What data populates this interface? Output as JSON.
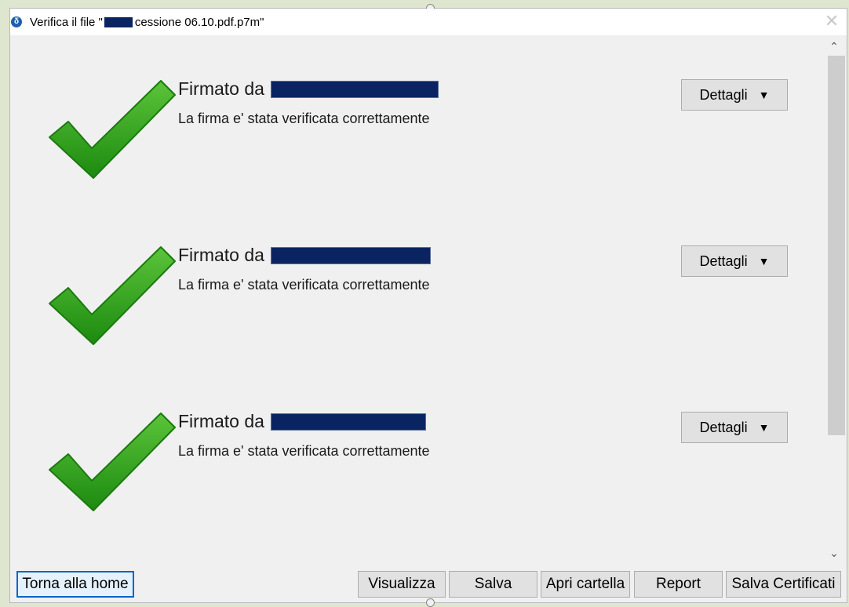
{
  "window": {
    "title_prefix": "Verifica il file \"",
    "title_suffix": "cessione 06.10.pdf.p7m\"",
    "app_icon": "δ",
    "close_symbol": "✕"
  },
  "signatures": [
    {
      "signer_label": "Firmato da",
      "status": "La firma e' stata verificata correttamente",
      "details_label": "Dettagli",
      "caret": "▼"
    },
    {
      "signer_label": "Firmato da",
      "status": "La firma e' stata verificata correttamente",
      "details_label": "Dettagli",
      "caret": "▼"
    },
    {
      "signer_label": "Firmato da",
      "status": "La firma e' stata verificata correttamente",
      "details_label": "Dettagli",
      "caret": "▼"
    }
  ],
  "scrollbar": {
    "up": "⌃",
    "down": "⌄"
  },
  "buttons": {
    "home": "Torna alla home",
    "view": "Visualizza",
    "save": "Salva",
    "open_folder": "Apri cartella",
    "report": "Report",
    "save_certs": "Salva Certificati"
  },
  "colors": {
    "check_green": "#2f9e1e",
    "redaction": "#0a2462",
    "focus_border": "#0a64c8"
  }
}
